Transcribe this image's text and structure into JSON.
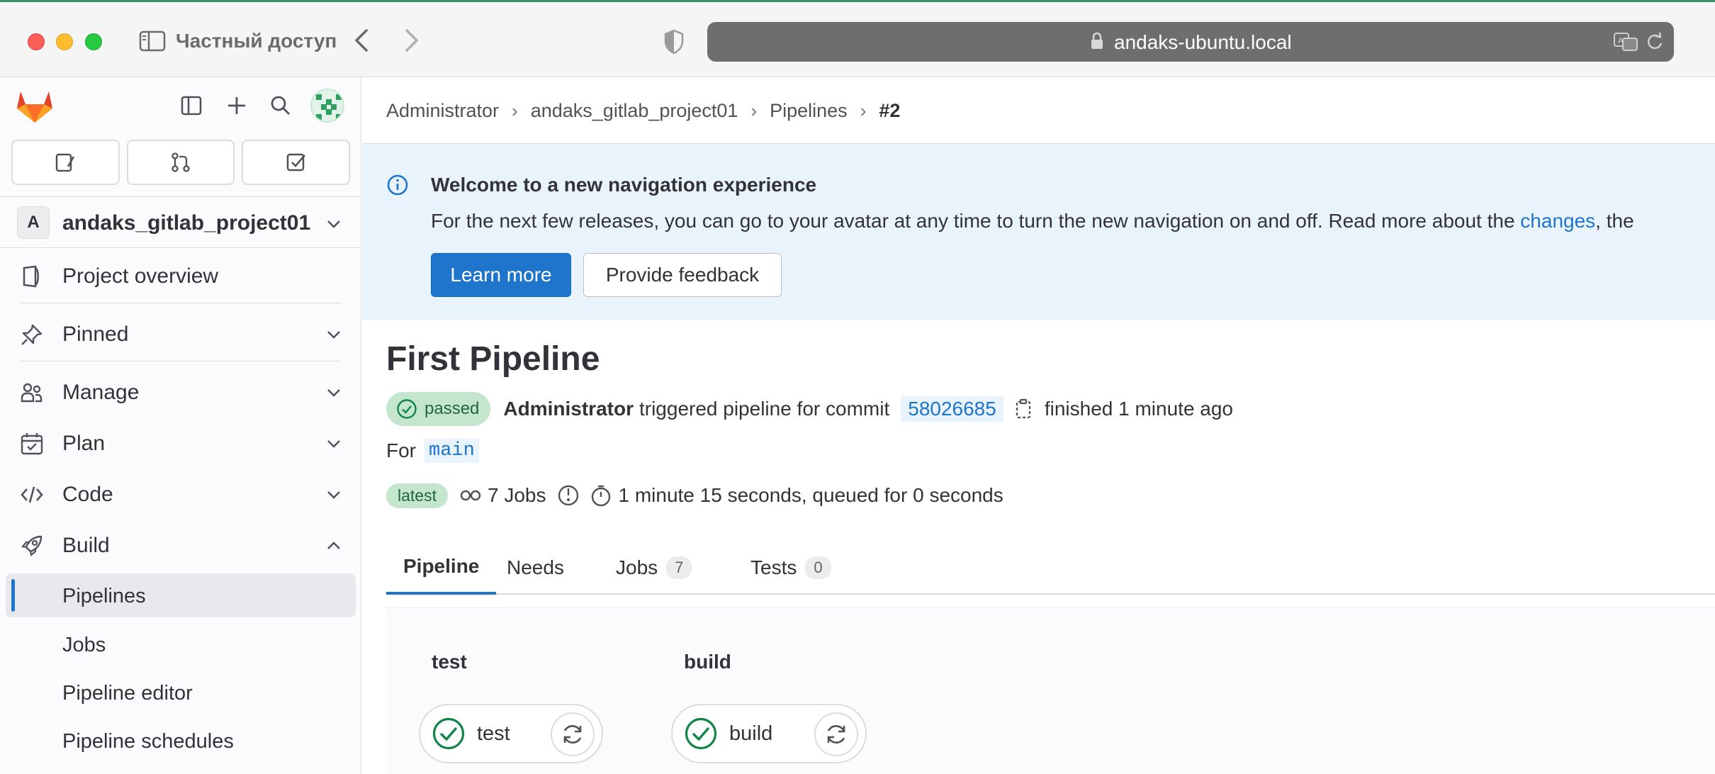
{
  "browser": {
    "private_label": "Частный доступ",
    "url": "andaks-ubuntu.local"
  },
  "sidebar": {
    "project_initial": "A",
    "project_name": "andaks_gitlab_project01",
    "items": [
      {
        "label": "Project overview",
        "icon": "project-icon"
      },
      {
        "label": "Pinned",
        "icon": "pin-icon"
      },
      {
        "label": "Manage",
        "icon": "users-icon"
      },
      {
        "label": "Plan",
        "icon": "calendar-icon"
      },
      {
        "label": "Code",
        "icon": "code-icon"
      },
      {
        "label": "Build",
        "icon": "rocket-icon"
      }
    ],
    "build_subitems": [
      {
        "label": "Pipelines",
        "active": true
      },
      {
        "label": "Jobs"
      },
      {
        "label": "Pipeline editor"
      },
      {
        "label": "Pipeline schedules"
      }
    ]
  },
  "breadcrumb": {
    "items": [
      "Administrator",
      "andaks_gitlab_project01",
      "Pipelines"
    ],
    "current": "#2"
  },
  "banner": {
    "title": "Welcome to a new navigation experience",
    "body": "For the next few releases, you can go to your avatar at any time to turn the new navigation on and off. Read more about the ",
    "link": "changes",
    "body_tail": ", the",
    "learn_more": "Learn more",
    "feedback": "Provide feedback"
  },
  "pipeline": {
    "title": "First Pipeline",
    "status": "passed",
    "author": "Administrator",
    "triggered_text": "triggered pipeline for commit",
    "commit": "58026685",
    "finished_text": "finished 1 minute ago",
    "for_label": "For",
    "branch": "main",
    "latest_badge": "latest",
    "jobs_text": "7 Jobs",
    "duration_text": "1 minute 15 seconds, queued for 0 seconds"
  },
  "tabs": [
    {
      "label": "Pipeline",
      "active": true
    },
    {
      "label": "Needs"
    },
    {
      "label": "Jobs",
      "count": "7"
    },
    {
      "label": "Tests",
      "count": "0"
    }
  ],
  "stages": [
    {
      "name": "test",
      "job": "test",
      "status": "success"
    },
    {
      "name": "build",
      "job": "build",
      "status": "success"
    }
  ],
  "colors": {
    "accent": "#1f75cb",
    "success": "#108548",
    "banner_bg": "#e9f3fc",
    "badge_bg": "#c3e6cd"
  }
}
